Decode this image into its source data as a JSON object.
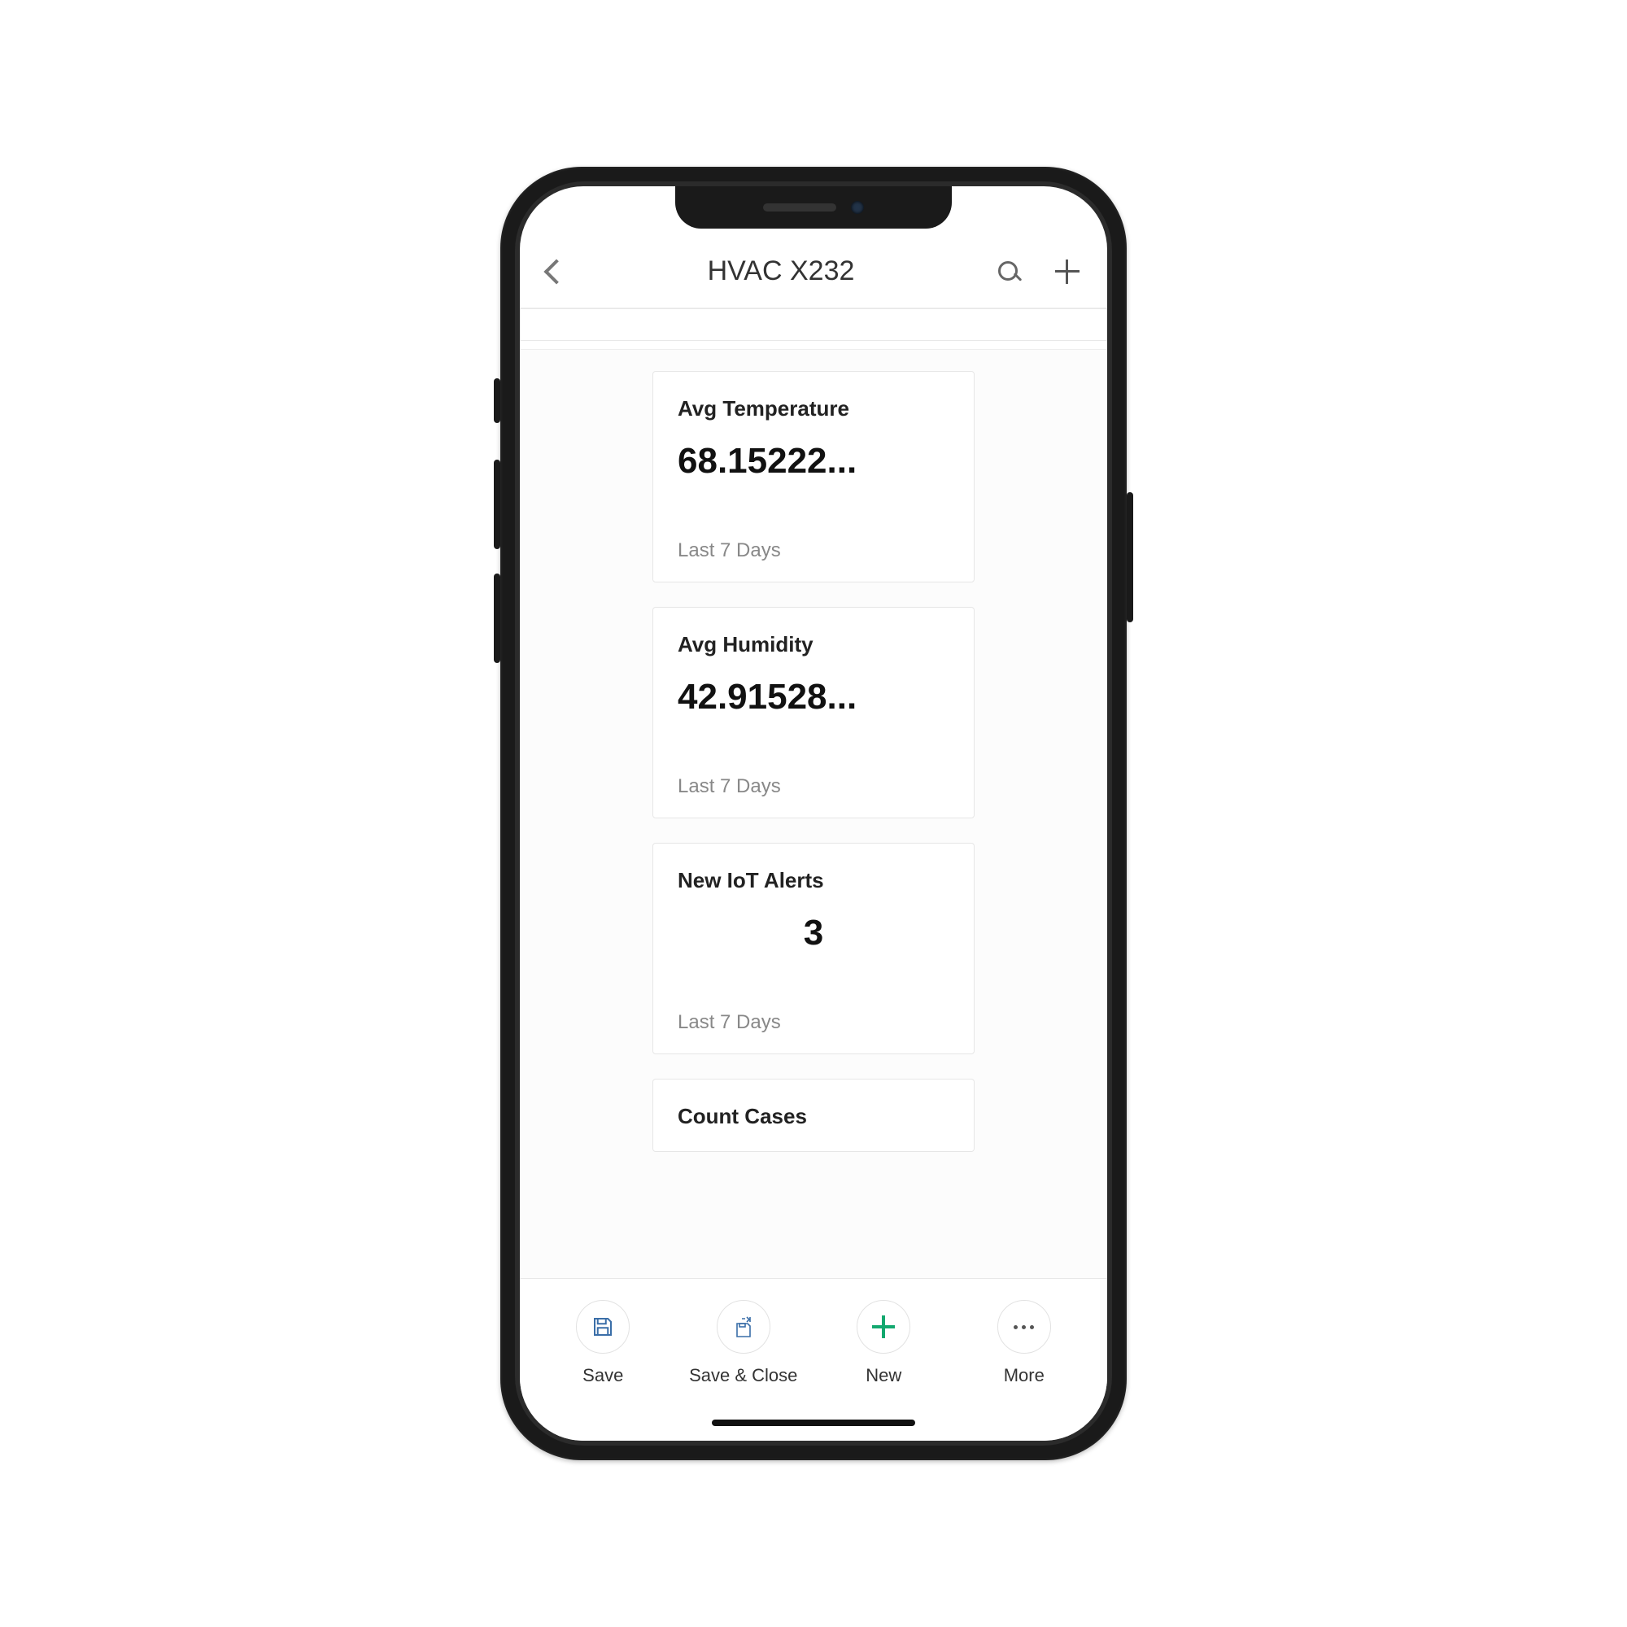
{
  "header": {
    "title": "HVAC X232"
  },
  "cards": [
    {
      "title": "Avg Temperature",
      "value": "68.15222...",
      "sub": "Last 7 Days",
      "centered": false
    },
    {
      "title": "Avg Humidity",
      "value": "42.91528...",
      "sub": "Last 7 Days",
      "centered": false
    },
    {
      "title": "New IoT Alerts",
      "value": "3",
      "sub": "Last 7 Days",
      "centered": true
    },
    {
      "title": "Count Cases",
      "value": "",
      "sub": "",
      "centered": false
    }
  ],
  "bottomBar": {
    "save": "Save",
    "saveClose": "Save & Close",
    "new": "New",
    "more": "More"
  }
}
